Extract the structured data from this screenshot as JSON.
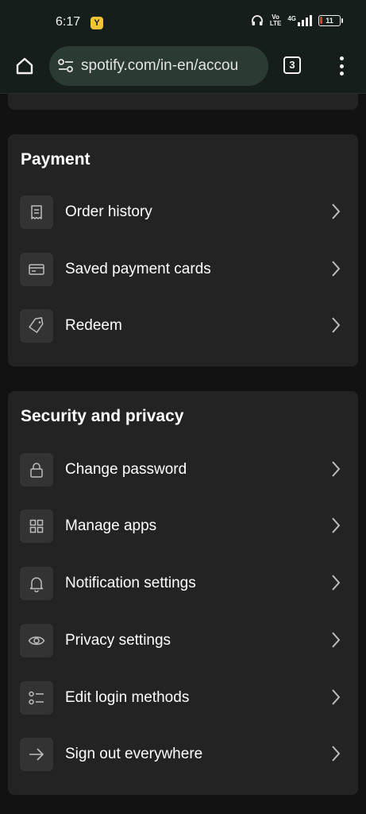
{
  "status_bar": {
    "time": "6:17",
    "notification_badge": "Y",
    "volte_top": "Vo",
    "volte_bottom": "LTE",
    "network": "4G",
    "battery_level": "11"
  },
  "browser": {
    "url": "spotify.com/in-en/accou",
    "tab_count": "3"
  },
  "payment": {
    "title": "Payment",
    "items": [
      {
        "label": "Order history",
        "icon": "receipt-icon"
      },
      {
        "label": "Saved payment cards",
        "icon": "credit-card-icon"
      },
      {
        "label": "Redeem",
        "icon": "tag-icon"
      }
    ]
  },
  "security": {
    "title": "Security and privacy",
    "items": [
      {
        "label": "Change password",
        "icon": "lock-icon"
      },
      {
        "label": "Manage apps",
        "icon": "grid-icon"
      },
      {
        "label": "Notification settings",
        "icon": "bell-icon"
      },
      {
        "label": "Privacy settings",
        "icon": "eye-icon"
      },
      {
        "label": "Edit login methods",
        "icon": "list-icon"
      },
      {
        "label": "Sign out everywhere",
        "icon": "arrow-right-icon"
      }
    ]
  },
  "colors": {
    "background": "#121212",
    "card": "#232323",
    "icon_tile": "#333333",
    "browser_bar": "#151e1a",
    "url_box": "#2b3a33"
  }
}
